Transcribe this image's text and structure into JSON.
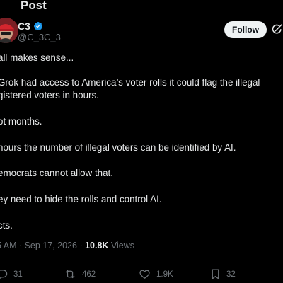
{
  "header": {
    "title": "Post"
  },
  "author": {
    "display_name": "C3",
    "handle": "@C_3C_3",
    "verified": true,
    "avatar_icon": "avatar-image"
  },
  "actions_top": {
    "follow_label": "Follow",
    "grok_icon": "grok-icon"
  },
  "post": {
    "lines": [
      "all makes sense...",
      "Grok had access to America’s voter rolls it could flag the illegal",
      "gistered voters in hours.",
      "ot months.",
      "hours the number of illegal voters can be identified by AI.",
      "emocrats cannot allow that.",
      "ey need to hide the rolls and control AI.",
      "cts."
    ]
  },
  "meta": {
    "time_date": "5 AM · Sep 17, 2026 · ",
    "views_count": "10.8K",
    "views_label": " Views"
  },
  "engagement": {
    "replies": "31",
    "reposts": "462",
    "likes": "1.9K",
    "bookmarks": "32"
  },
  "colors": {
    "background": "#000000",
    "text": "#e7e9ea",
    "secondary": "#71767b",
    "verified": "#1d9bf0",
    "follow_bg": "#eff3f4"
  }
}
